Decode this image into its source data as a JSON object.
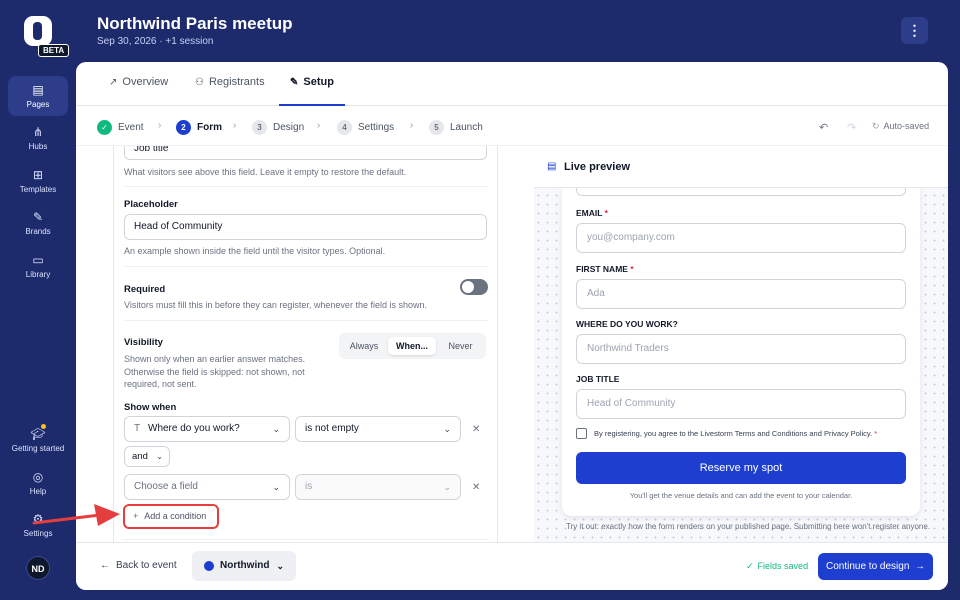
{
  "app": {
    "beta": "BETA",
    "user_initials": "ND"
  },
  "nav": {
    "pages": "Pages",
    "hubs": "Hubs",
    "templates": "Templates",
    "brands": "Brands",
    "library": "Library",
    "getting_started": "Getting started",
    "help": "Help",
    "settings": "Settings"
  },
  "header": {
    "title": "Northwind Paris meetup",
    "subtitle": "Sep 30, 2026 · +1 session",
    "menu_icon": "⋮"
  },
  "tabs": {
    "overview": "Overview",
    "registrants": "Registrants",
    "setup": "Setup",
    "active": "Setup"
  },
  "steps": {
    "s1": {
      "num": "✓",
      "label": "Event",
      "state": "done"
    },
    "s2": {
      "num": "2",
      "label": "Form",
      "state": "current"
    },
    "s3": {
      "num": "3",
      "label": "Design",
      "state": "todo"
    },
    "s4": {
      "num": "4",
      "label": "Settings",
      "state": "todo"
    },
    "s5": {
      "num": "5",
      "label": "Launch",
      "state": "todo"
    },
    "autosaved": "Auto-saved"
  },
  "editor": {
    "label_value": "Job title",
    "label_help": "What visitors see above this field. Leave it empty to restore the default.",
    "placeholder_label": "Placeholder",
    "placeholder_value": "Head of Community",
    "placeholder_help": "An example shown inside the field until the visitor types. Optional.",
    "required_label": "Required",
    "required_help": "Visitors must fill this in before they can register, whenever the field is shown.",
    "required_on": false,
    "visibility_label": "Visibility",
    "visibility_help_1": "Shown only when an earlier answer matches.",
    "visibility_help_2": "Otherwise the field is skipped: not shown, not",
    "visibility_help_3": "required, not sent.",
    "visibility_options": {
      "always": "Always",
      "when": "When...",
      "never": "Never"
    },
    "visibility_selected": "When...",
    "show_when_label": "Show when",
    "cond1_field": "Where do you work?",
    "cond1_operator": "is not empty",
    "joiner": "and",
    "cond2_field": "Choose a field",
    "cond2_operator": "is",
    "add_condition": "Add a condition"
  },
  "preview": {
    "title": "Live preview",
    "email_label": "EMAIL",
    "email_placeholder": "you@company.com",
    "first_name_label": "FIRST NAME",
    "first_name_placeholder": "Ada",
    "work_label": "WHERE DO YOU WORK?",
    "work_placeholder": "Northwind Traders",
    "job_label": "JOB TITLE",
    "job_placeholder": "Head of Community",
    "required_mark": "*",
    "consent": "By registering, you agree to the Livestorm Terms and Conditions and Privacy Policy.",
    "button": "Reserve my spot",
    "venue_note": "You'll get the venue details and can add the event to your calendar.",
    "try_note": "Try it out: exactly how the form renders on your published page. Submitting here won't register anyone."
  },
  "footer": {
    "back": "Back to event",
    "brand": "Northwind",
    "saved": "Fields saved",
    "continue": "Continue to design"
  },
  "colors": {
    "accent": "#1d3ecf",
    "nav_bg": "#1d2a6b",
    "success": "#10b981",
    "highlight": "#e53e3e"
  }
}
